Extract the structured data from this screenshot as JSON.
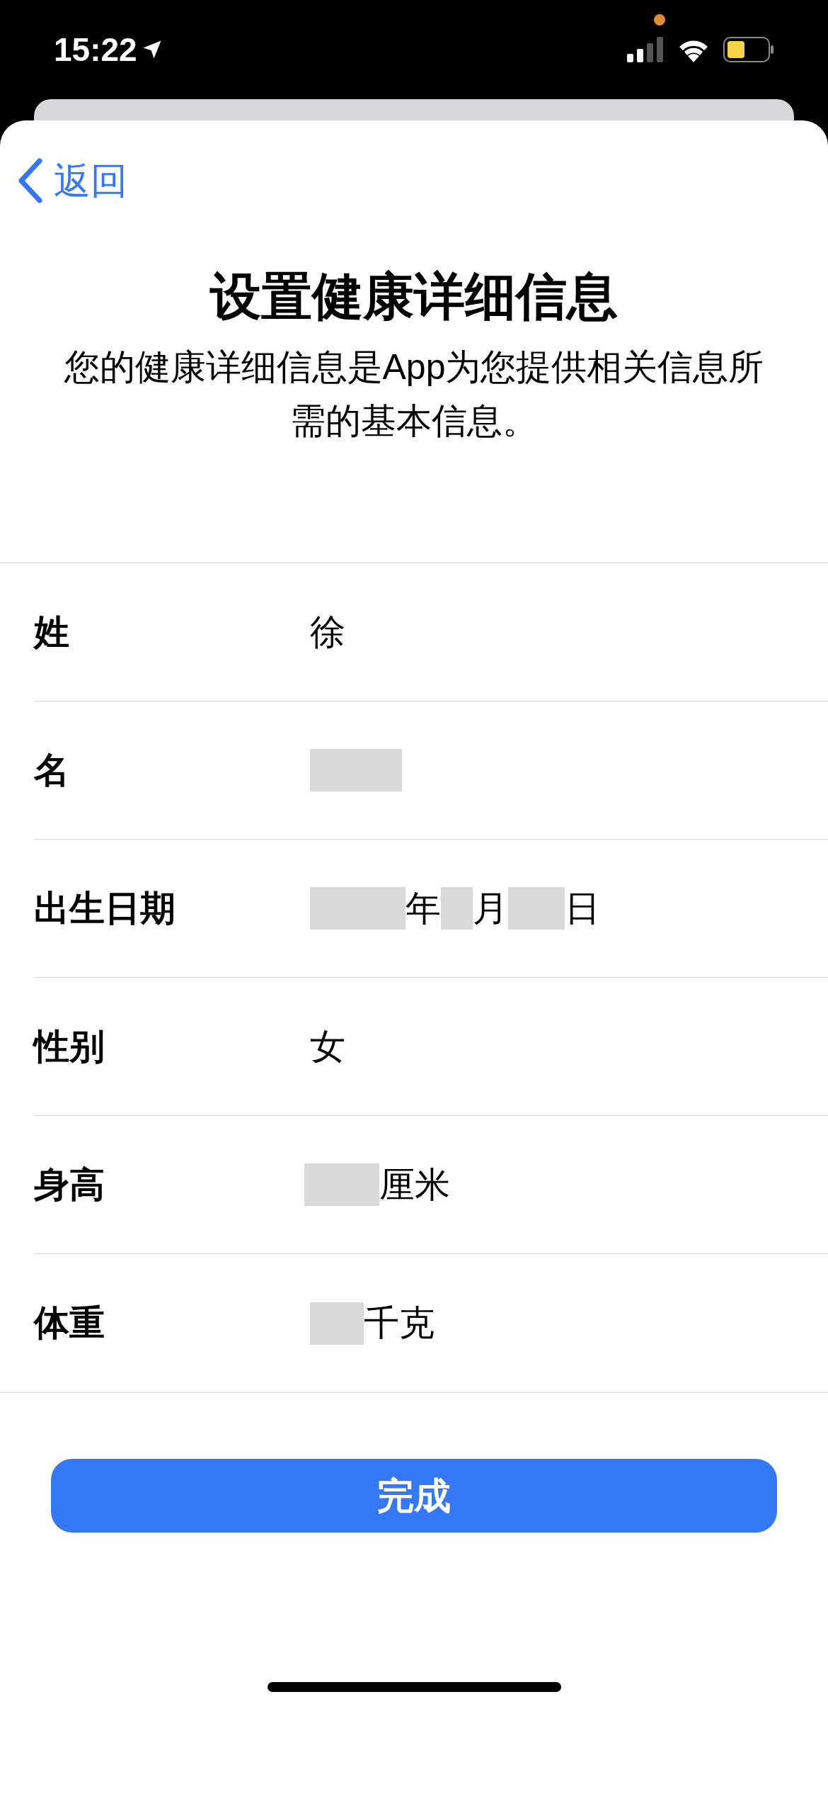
{
  "status_bar": {
    "time": "15:22"
  },
  "nav": {
    "back": "返回"
  },
  "title": "设置健康详细信息",
  "subtitle": "您的健康详细信息是App为您提供相关信息所需的基本信息。",
  "fields": [
    {
      "label": "姓",
      "value": [
        {
          "kind": "text",
          "text": "徐"
        }
      ]
    },
    {
      "label": "名",
      "value": [
        {
          "kind": "redacted"
        }
      ]
    },
    {
      "label": "出生日期",
      "value": [
        {
          "kind": "redacted"
        },
        {
          "kind": "text",
          "text": "年"
        },
        {
          "kind": "redacted"
        },
        {
          "kind": "text",
          "text": "月"
        },
        {
          "kind": "redacted"
        },
        {
          "kind": "text",
          "text": "日"
        }
      ]
    },
    {
      "label": "性别",
      "value": [
        {
          "kind": "text",
          "text": "女"
        }
      ]
    },
    {
      "label": "身高",
      "value": [
        {
          "kind": "redacted"
        },
        {
          "kind": "text",
          "text": "厘米"
        }
      ]
    },
    {
      "label": "体重",
      "value": [
        {
          "kind": "redacted"
        },
        {
          "kind": "text",
          "text": "千克"
        }
      ]
    }
  ],
  "done_button": "完成"
}
